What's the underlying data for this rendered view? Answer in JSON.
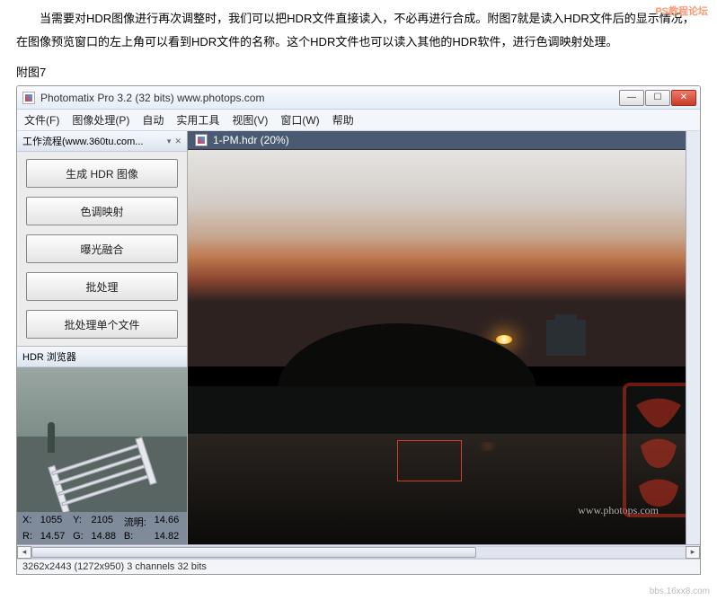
{
  "watermark_top": "PS教程论坛",
  "watermark_bottom": "bbs.16xx8.com",
  "intro_p1": "当需要对HDR图像进行再次调整时，我们可以把HDR文件直接读入，不必再进行合成。附图7就是读入HDR文件后的显示情况，",
  "intro_p2": "在图像预览窗口的左上角可以看到HDR文件的名称。这个HDR文件也可以读入其他的HDR软件，进行色调映射处理。",
  "caption": "附图7",
  "window": {
    "title": "Photomatix Pro 3.2 (32 bits)   www.photops.com",
    "min": "—",
    "max": "☐",
    "close": "✕"
  },
  "menu": {
    "file": "文件(F)",
    "process": "图像处理(P)",
    "auto": "自动",
    "tools": "实用工具",
    "view": "视图(V)",
    "window": "窗口(W)",
    "help": "帮助"
  },
  "workflow": {
    "header": "工作流程(www.360tu.com...",
    "close_icon": "✕",
    "b1": "生成 HDR 图像",
    "b2": "色调映射",
    "b3": "曝光融合",
    "b4": "批处理",
    "b5": "批处理单个文件"
  },
  "hdr_browser": {
    "header": "HDR 浏览器",
    "info": {
      "xlbl": "X:",
      "x": "1055",
      "ylbl": "Y:",
      "y": "2105",
      "lumlbl": "流明:",
      "lum": "14.66",
      "rlbl": "R:",
      "r": "14.57",
      "glbl": "G:",
      "g": "14.88",
      "blbl": "B:",
      "b": "14.82"
    }
  },
  "doc_tab": "1-PM.hdr (20%)",
  "photops_url": "www.photops.com",
  "statusbar": "3262x2443 (1272x950) 3 channels 32 bits"
}
